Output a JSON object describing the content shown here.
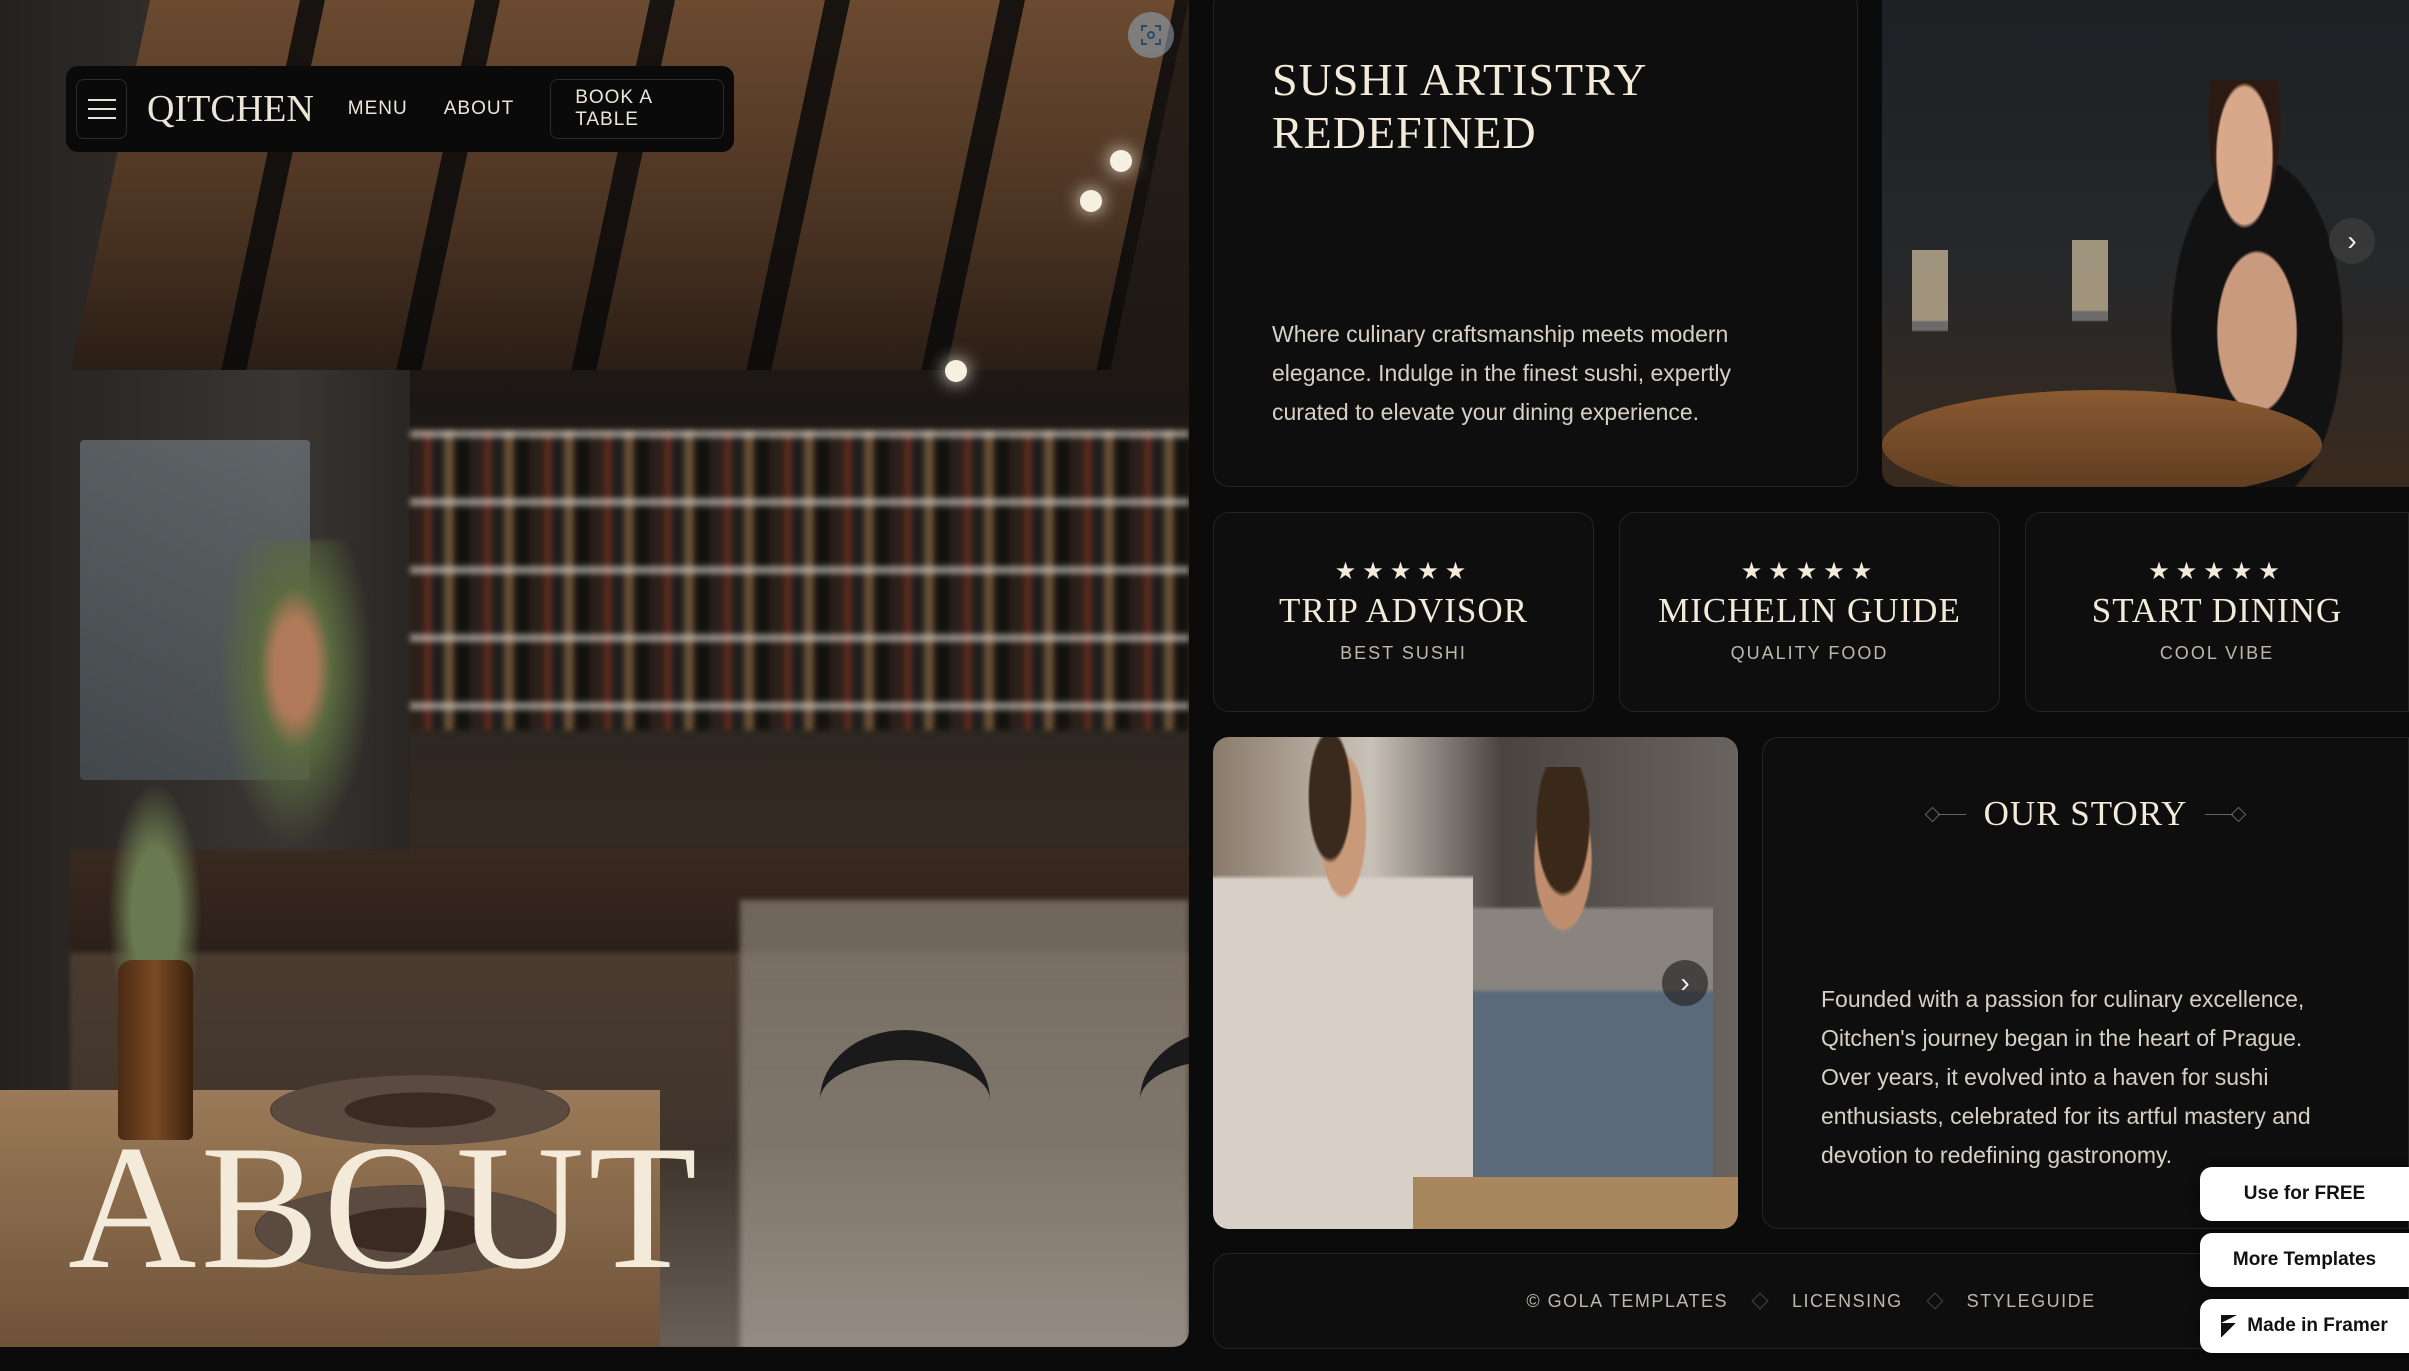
{
  "nav": {
    "logo": "QITCHEN",
    "links": [
      "MENU",
      "ABOUT"
    ],
    "cta": "BOOK A TABLE"
  },
  "hero": {
    "title": "ABOUT"
  },
  "intro": {
    "title": "SUSHI ARTISTRY REDEFINED",
    "text": "Where culinary craftsmanship meets modern elegance. Indulge in the finest sushi, expertly curated to elevate your dining experience."
  },
  "awards": [
    {
      "stars": "★★★★★",
      "title": "TRIP ADVISOR",
      "subtitle": "BEST SUSHI"
    },
    {
      "stars": "★★★★★",
      "title": "MICHELIN GUIDE",
      "subtitle": "QUALITY FOOD"
    },
    {
      "stars": "★★★★★",
      "title": "START DINING",
      "subtitle": "COOL VIBE"
    }
  ],
  "story": {
    "title": "OUR STORY",
    "text": "Founded with a passion for culinary excellence, Qitchen's journey began in the heart of Prague. Over years, it evolved into a haven for sushi enthusiasts, celebrated for its artful mastery and devotion to redefining gastronomy."
  },
  "footer": {
    "items": [
      "© GOLA TEMPLATES",
      "LICENSING",
      "STYLEGUIDE"
    ]
  },
  "framer": {
    "use_free": "Use for FREE",
    "more_templates": "More Templates",
    "made_in": "Made in Framer"
  },
  "icons": {
    "menu": "hamburger-icon",
    "scan": "scan-icon",
    "next": "chevron-right-icon",
    "star": "star-icon",
    "framer": "framer-icon"
  },
  "colors": {
    "background": "#0b0b0b",
    "card": "#0e0e0e",
    "text": "#ece6da",
    "muted": "#bfb8ac"
  }
}
